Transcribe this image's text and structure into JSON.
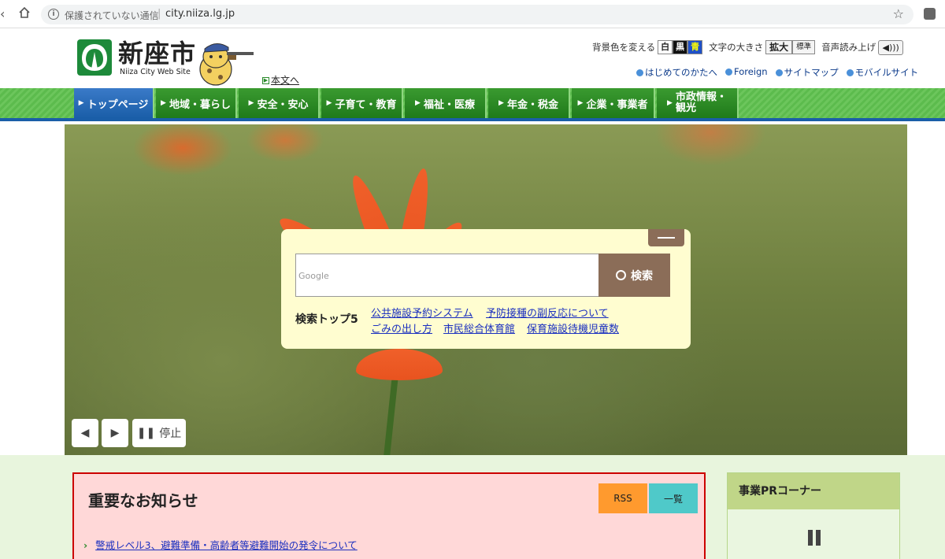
{
  "browser": {
    "insecure_label": "保護されていない通信",
    "url": "city.niiza.lg.jp"
  },
  "header": {
    "logo_text": "新座市",
    "logo_sub": "Niiza City Web Site",
    "skip_link": "本文へ",
    "bg_label": "背景色を変える",
    "bg_white": "白",
    "bg_black": "黒",
    "bg_blue": "青",
    "size_label": "文字の大きさ",
    "size_large": "拡大",
    "size_std": "標準",
    "speech_label": "音声読み上げ",
    "links": [
      "はじめてのかたへ",
      "Foreign",
      "サイトマップ",
      "モバイルサイト"
    ]
  },
  "nav": {
    "items": [
      "トップページ",
      "地域・暮らし",
      "安全・安心",
      "子育て・教育",
      "福祉・医療",
      "年金・税金",
      "企業・事業者",
      "市政情報・",
      "観光"
    ]
  },
  "hero": {
    "pause_label": "停止"
  },
  "search": {
    "placeholder": "Google",
    "button_label": "検索",
    "top5_label": "検索トップ5",
    "top5": [
      "公共施設予約システム",
      "予防接種の副反応について",
      "ごみの出し方",
      "市民総合体育館",
      "保育施設待機児童数"
    ]
  },
  "notice": {
    "title": "重要なお知らせ",
    "rss_label": "RSS",
    "list_label": "一覧",
    "items": [
      "警戒レベル3、避難準備・高齢者等避難開始の発令について"
    ]
  },
  "pr": {
    "title": "事業PRコーナー"
  },
  "colors": {
    "nav_green": "#2a8a22",
    "nav_active_blue": "#1a5ea8",
    "search_brown": "#8b6d58",
    "search_panel": "#fffdd0",
    "notice_bg": "#ffd8d8",
    "notice_border": "#cc0000",
    "rss_orange": "#ff9a2e",
    "list_teal": "#4fc9c9"
  }
}
